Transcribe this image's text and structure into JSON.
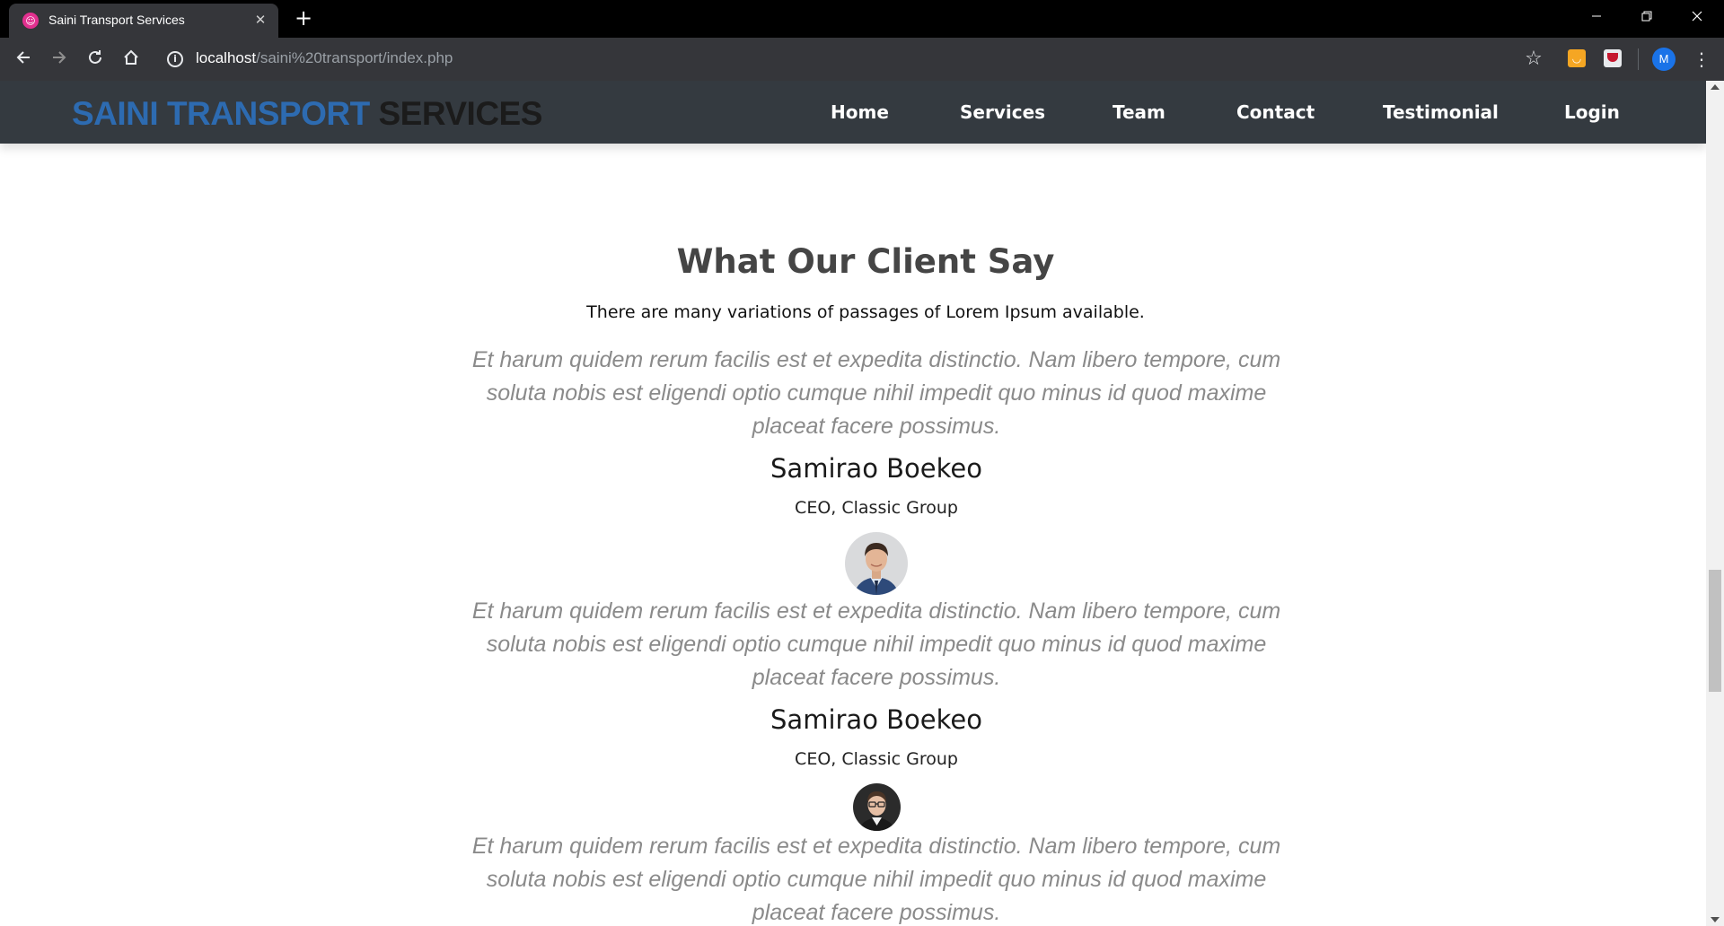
{
  "browser": {
    "tab_title": "Saini Transport Services",
    "tab_close": "✕",
    "new_tab": "+",
    "url_host": "localhost",
    "url_path": "/saini%20transport/index.php",
    "profile_initial": "M"
  },
  "site": {
    "brand_part1": "SAINI TRANSPORT",
    "brand_part2": " SERVICES",
    "nav": [
      "Home",
      "Services",
      "Team",
      "Contact",
      "Testimonial",
      "Login"
    ]
  },
  "testimonials_section": {
    "title": "What Our Client Say",
    "subtitle": "There are many variations of passages of Lorem Ipsum available.",
    "items": [
      {
        "quote": "Et harum quidem rerum facilis est et expedita distinctio. Nam libero tempore, cum soluta nobis est eligendi optio cumque nihil impedit quo minus id quod maxime placeat facere possimus.",
        "name": "Samirao Boekeo",
        "role": "CEO, Classic Group",
        "avatar": "man-in-suit-avatar"
      },
      {
        "quote": "Et harum quidem rerum facilis est et expedita distinctio. Nam libero tempore, cum soluta nobis est eligendi optio cumque nihil impedit quo minus id quod maxime placeat facere possimus.",
        "name": "Samirao Boekeo",
        "role": "CEO, Classic Group",
        "avatar": "man-with-glasses-avatar"
      },
      {
        "quote": "Et harum quidem rerum facilis est et expedita distinctio. Nam libero tempore, cum soluta nobis est eligendi optio cumque nihil impedit quo minus id quod maxime placeat facere possimus."
      }
    ]
  },
  "colors": {
    "header_bg": "#343a40",
    "brand_blue": "#2d6bb1",
    "quote_gray": "#8a8a8a",
    "browser_frame": "#35363a"
  }
}
